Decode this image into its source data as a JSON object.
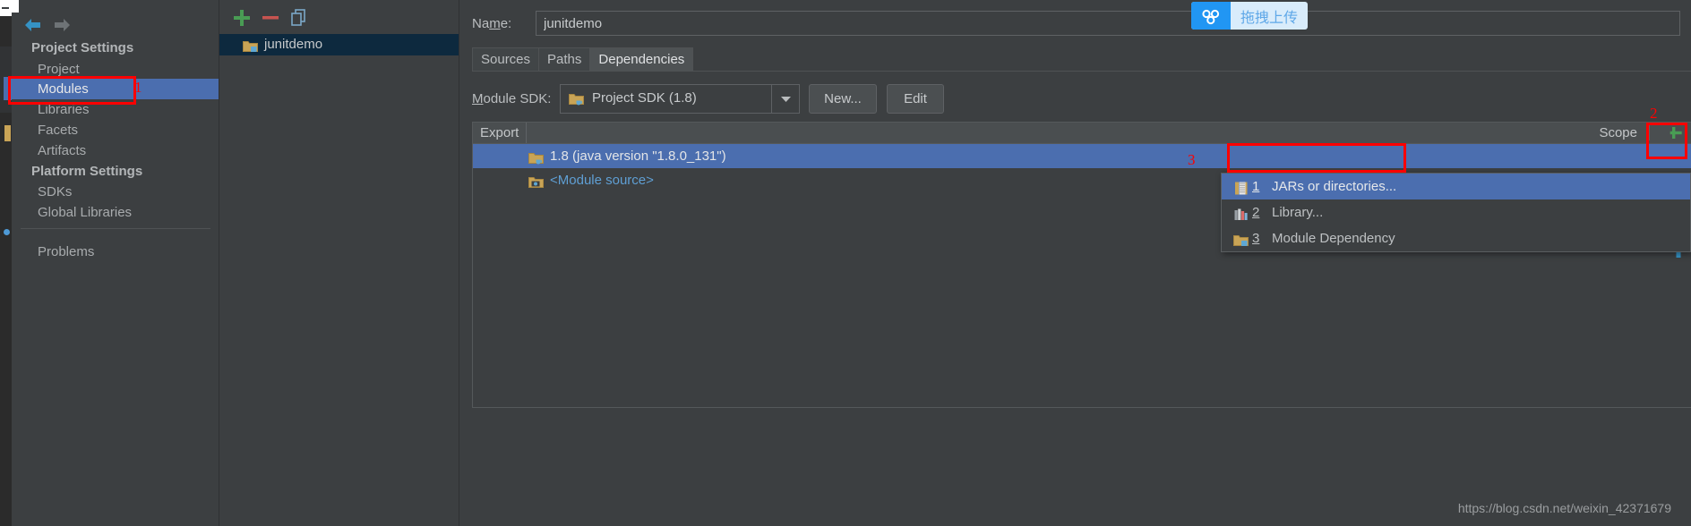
{
  "window": {
    "background_color": "#3c3f41",
    "accent_selection_color": "#4b6eaf",
    "annotation_color": "#fe0000"
  },
  "nav": {
    "back_icon": "arrow-left-icon",
    "forward_icon": "arrow-right-icon",
    "sections": [
      {
        "title": "Project Settings",
        "items": [
          {
            "label": "Project",
            "selected": false
          },
          {
            "label": "Modules",
            "selected": true
          },
          {
            "label": "Libraries",
            "selected": false
          },
          {
            "label": "Facets",
            "selected": false
          },
          {
            "label": "Artifacts",
            "selected": false
          }
        ]
      },
      {
        "title": "Platform Settings",
        "items": [
          {
            "label": "SDKs",
            "selected": false
          },
          {
            "label": "Global Libraries",
            "selected": false
          }
        ]
      }
    ],
    "footer_items": [
      {
        "label": "Problems",
        "selected": false
      }
    ]
  },
  "modules_panel": {
    "toolbar": [
      {
        "name": "add-module-icon",
        "glyph": "+",
        "color": "#499c54"
      },
      {
        "name": "remove-module-icon",
        "glyph": "–",
        "color": "#c75450"
      },
      {
        "name": "copy-module-icon",
        "glyph": "copy",
        "color": "#7aa7c7"
      }
    ],
    "modules": [
      {
        "label": "junitdemo",
        "icon": "module-folder-icon",
        "selected": true
      }
    ]
  },
  "detail": {
    "name_label": "Name:",
    "name_label_mnemonic": "m",
    "name_value": "junitdemo",
    "tabs": [
      {
        "label": "Sources",
        "active": false
      },
      {
        "label": "Paths",
        "active": false
      },
      {
        "label": "Dependencies",
        "active": true
      }
    ],
    "sdk_label": "Module SDK:",
    "sdk_label_mnemonic": "M",
    "sdk_value": "Project SDK (1.8)",
    "sdk_icon": "sdk-folder-icon",
    "sdk_dropdown_icon": "chevron-down-icon",
    "new_button": "New...",
    "edit_button": "Edit",
    "table": {
      "columns": [
        "Export",
        "Scope"
      ],
      "add_icon": "plus-icon",
      "rows": [
        {
          "label": "1.8 (java version \"1.8.0_131\")",
          "icon": "sdk-folder-icon",
          "selected": true,
          "scope": ""
        },
        {
          "label": "<Module source>",
          "icon": "module-source-icon",
          "selected": false,
          "scope": ""
        }
      ]
    },
    "scroll_down_icon": "arrow-down-icon",
    "scroll_up_icon": "arrow-up-icon"
  },
  "add_dependency_menu": {
    "items": [
      {
        "number": "1",
        "label": "JARs or directories...",
        "icon": "jar-icon",
        "highlighted": true
      },
      {
        "number": "2",
        "label": "Library...",
        "icon": "library-icon",
        "highlighted": false
      },
      {
        "number": "3",
        "label": "Module Dependency",
        "icon": "module-folder-icon",
        "highlighted": false
      }
    ]
  },
  "annotations": {
    "marks": [
      {
        "number": "1",
        "target": "modules-nav-item"
      },
      {
        "number": "2",
        "target": "add-dependency-plus-button"
      },
      {
        "number": "3",
        "target": "jars-or-directories-menu-item"
      }
    ]
  },
  "upload_badge": {
    "icon": "baidu-cloud-icon",
    "label": "拖拽上传"
  },
  "watermark": "https://blog.csdn.net/weixin_42371679"
}
